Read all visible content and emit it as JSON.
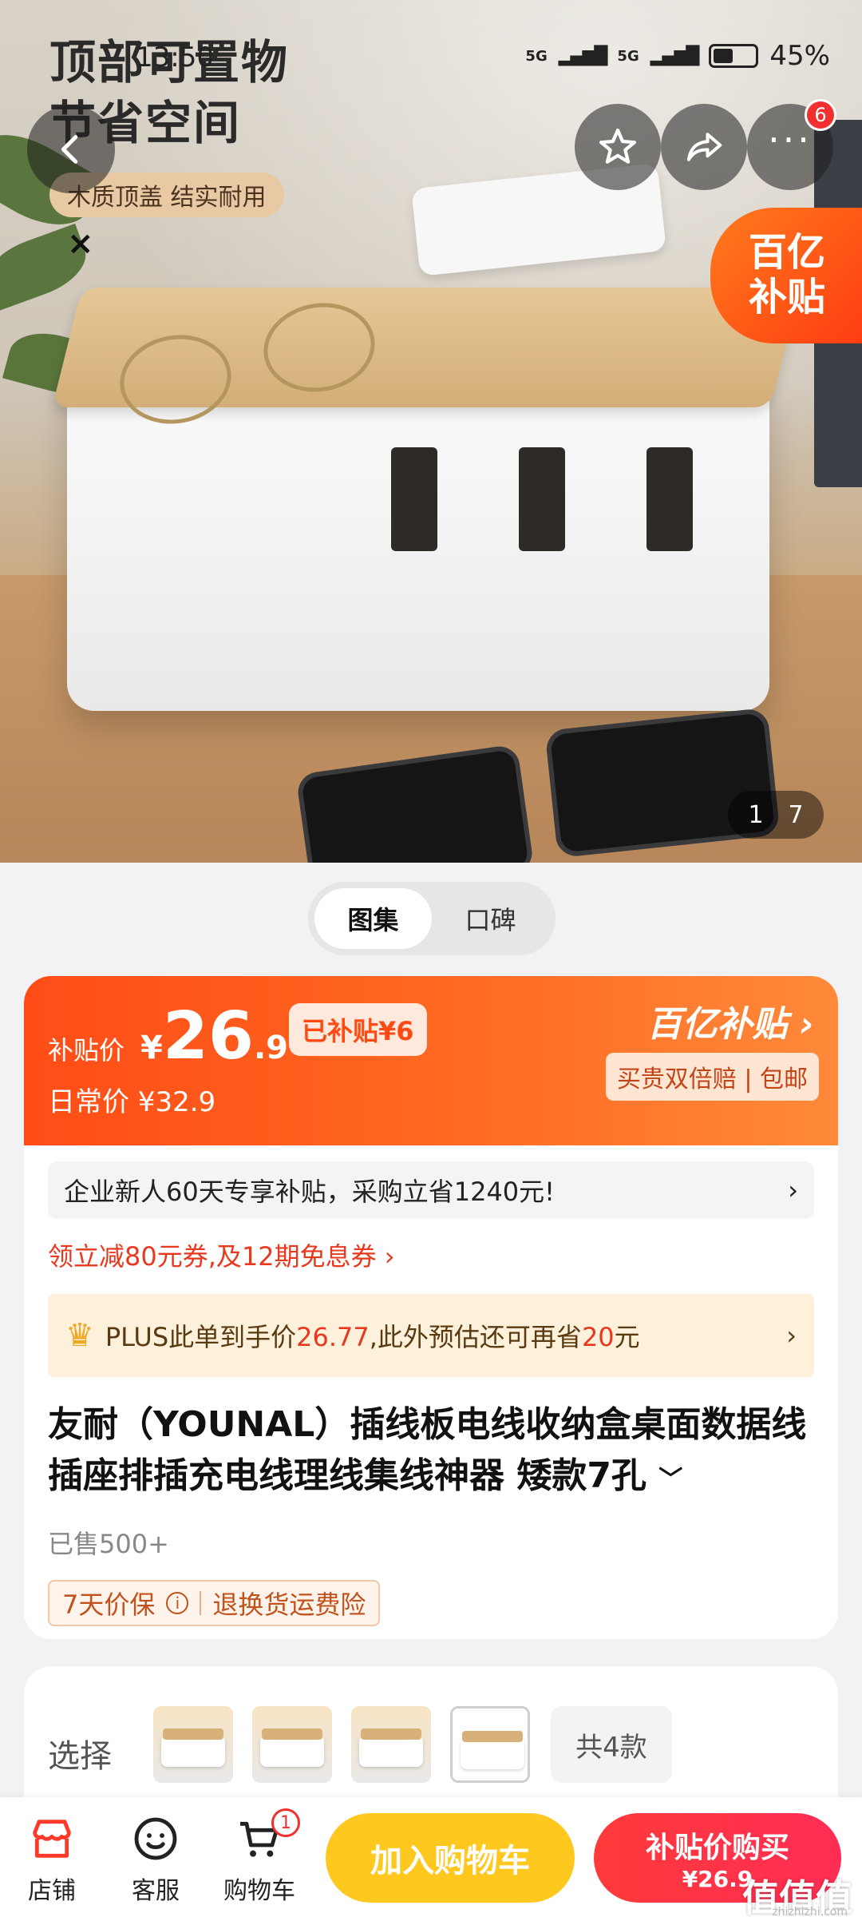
{
  "status_bar": {
    "time": "13:50",
    "signal_1": "5G",
    "signal_2": "5G",
    "battery": "45%"
  },
  "hero": {
    "promo_title_line1": "顶部可置物",
    "promo_title_line2": "节省空间",
    "promo_tag": "木质顶盖 结实耐用",
    "close_glyph": "×",
    "yiyi_badge_line1": "百亿",
    "yiyi_badge_line2": "补贴",
    "more_badge_count": "6",
    "image_index": "1",
    "image_total": "7"
  },
  "gallery_toggle": {
    "tabs": [
      {
        "label": "图集",
        "active": true
      },
      {
        "label": "口碑",
        "active": false
      }
    ]
  },
  "price": {
    "label": "补贴价",
    "currency": "¥",
    "integer": "26",
    "decimal": ".9",
    "subsidy_chip": "已补贴¥6",
    "regular_price": "日常价 ¥32.9",
    "yiyi_label": "百亿补贴 ›",
    "guarantee": "买贵双倍赔 | 包邮"
  },
  "newcomer": {
    "text": "企业新人60天专享补贴，采购立省1240元!",
    "arrow": "›"
  },
  "coupon": {
    "text": "领立减80元券,及12期免息券 ›"
  },
  "plus": {
    "prefix": "PLUS此单到手价",
    "price": "26.77",
    "middle": ",此外预估还可再省",
    "save": "20",
    "suffix": "元",
    "arrow": "›"
  },
  "product": {
    "title": "友耐（YOUNAL）插线板电线收纳盒桌面数据线插座排插充电线理线集线神器 矮款7孔",
    "expand": "﹀",
    "sold": "已售500+",
    "tag_1": "7天价保",
    "tag_info": "i",
    "tag_2": "退换货运费险"
  },
  "variants": {
    "label": "选择",
    "count": "共4款"
  },
  "bottom_bar": {
    "store": "店铺",
    "service": "客服",
    "cart": "购物车",
    "cart_count": "1",
    "add_to_cart": "加入购物车",
    "buy_label": "补贴价购买",
    "buy_price": "¥26.9"
  },
  "watermark": {
    "text": "值值值",
    "sub": "zhizhizhi.com"
  },
  "colors": {
    "accent": "#ff4c16",
    "buy": "#ff2d55",
    "cart": "#ffc81e"
  }
}
